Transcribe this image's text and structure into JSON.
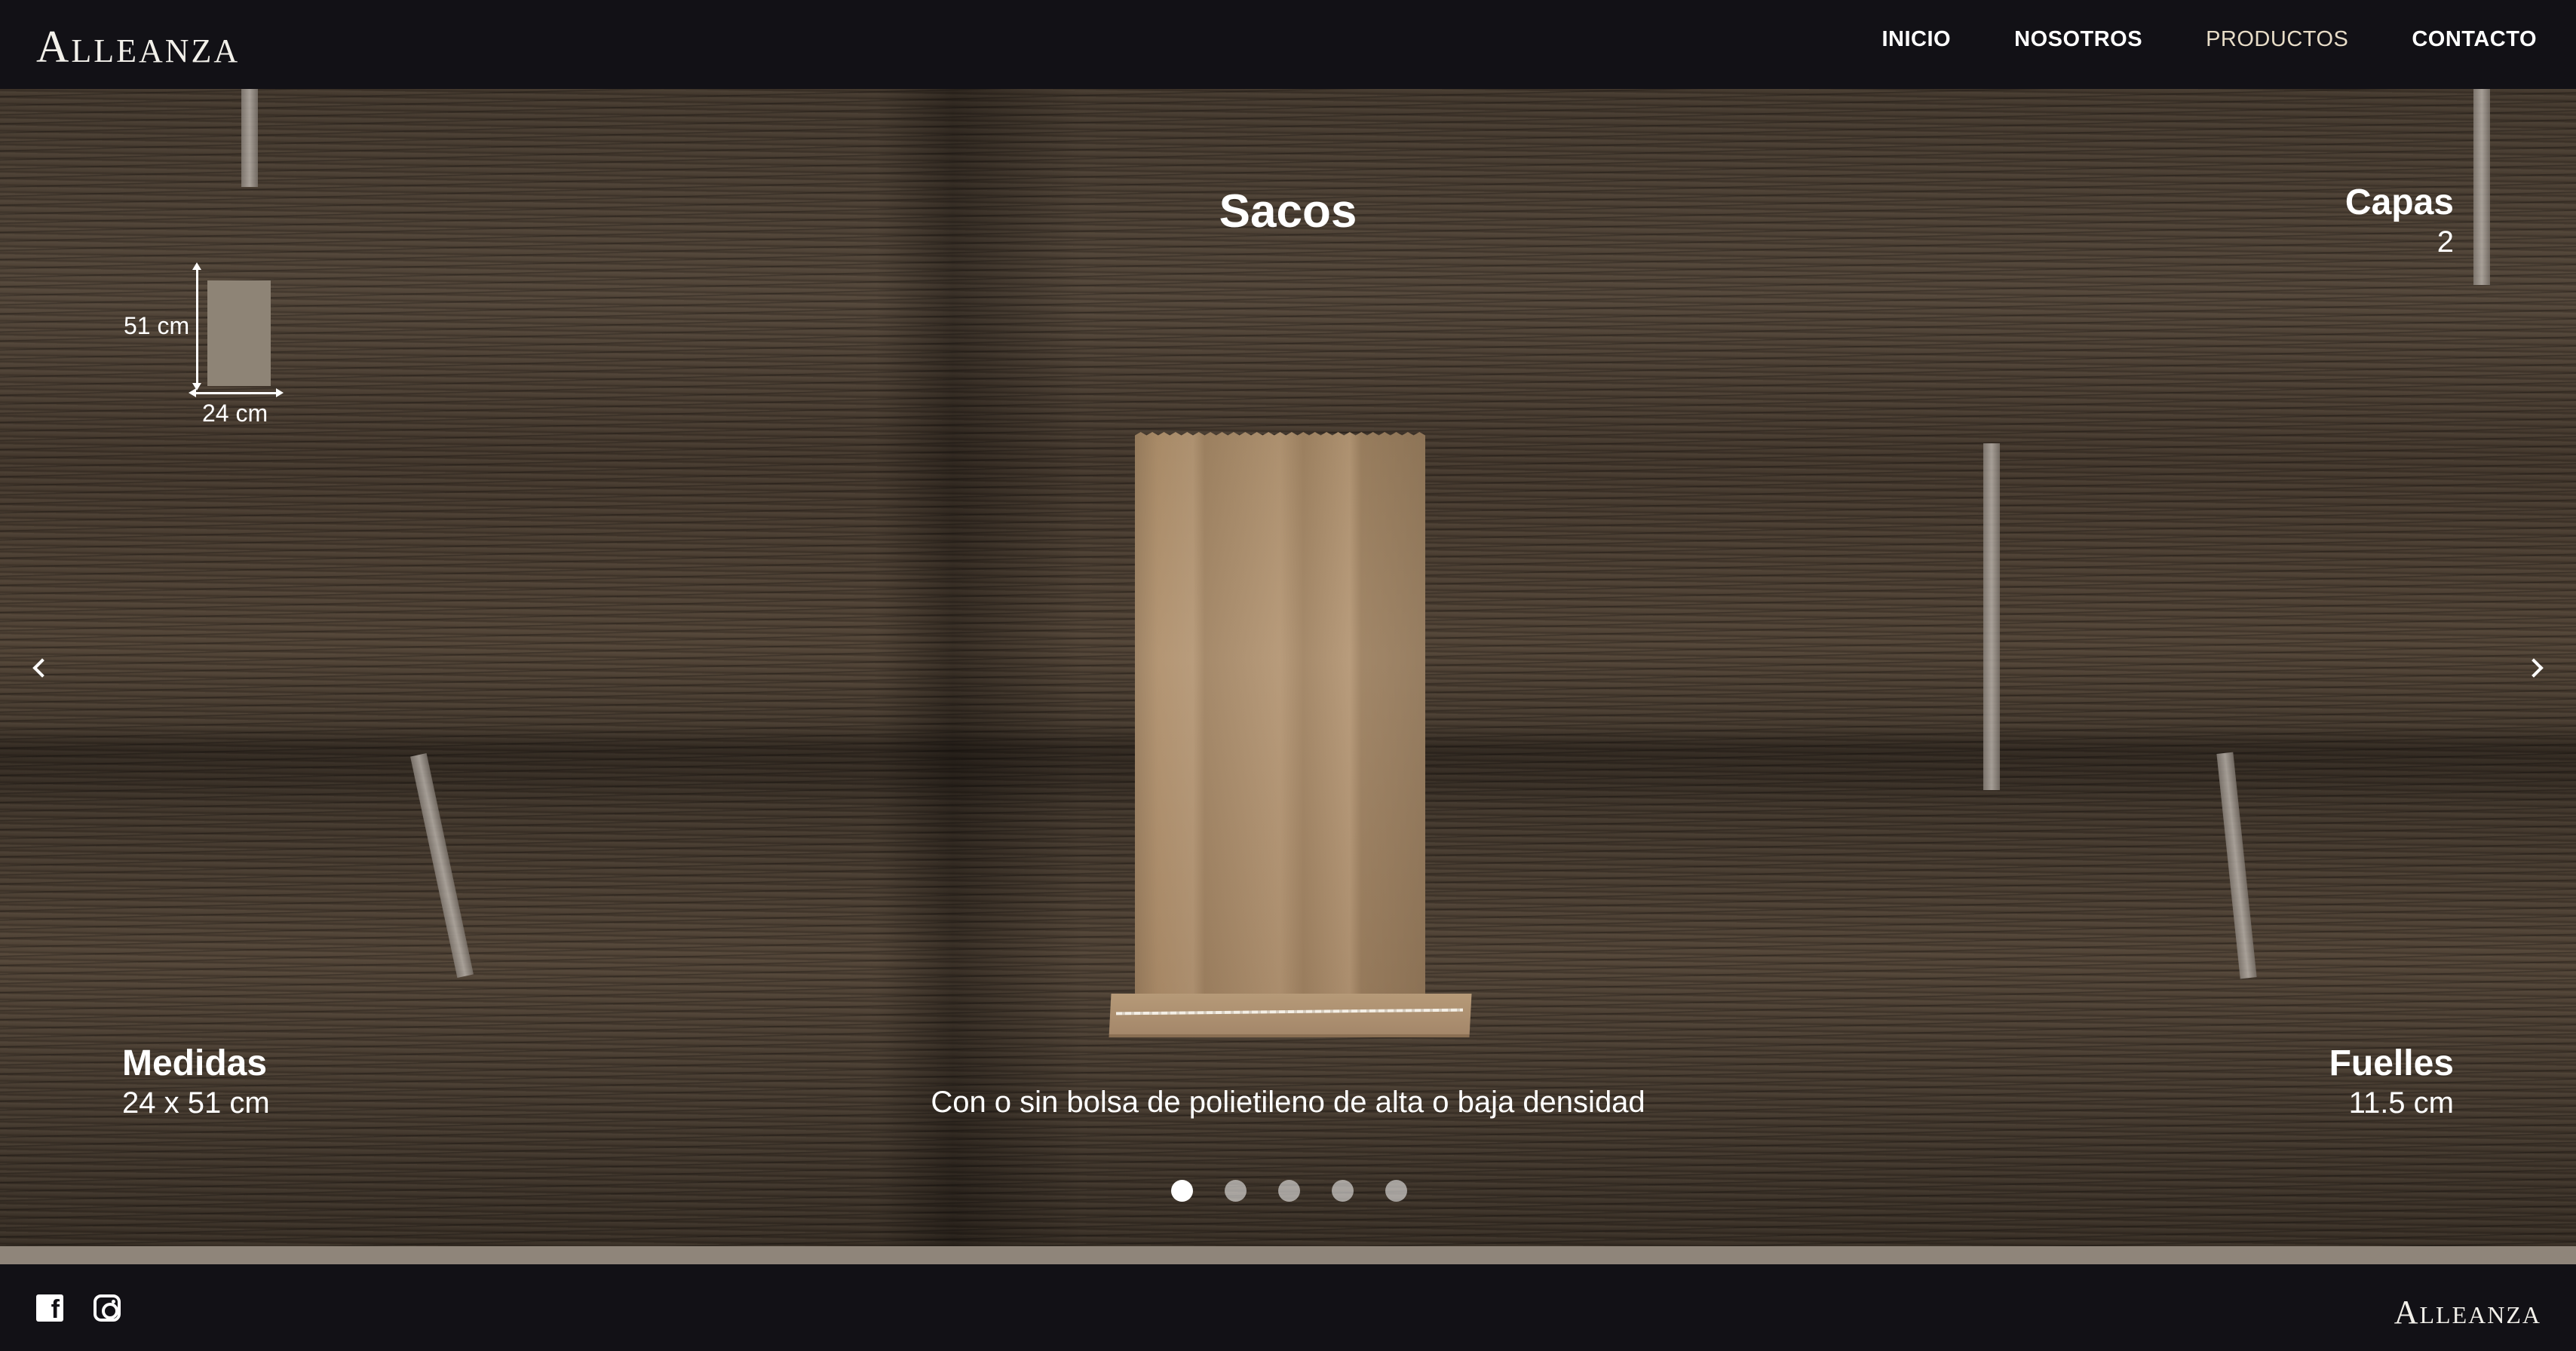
{
  "brand": {
    "logo_first": "A",
    "logo_rest": "LLEANZA"
  },
  "nav": {
    "items": [
      {
        "label": "INICIO",
        "active": false
      },
      {
        "label": "NOSOTROS",
        "active": false
      },
      {
        "label": "PRODUCTOS",
        "active": true
      },
      {
        "label": "CONTACTO",
        "active": false
      }
    ]
  },
  "product": {
    "title": "Sacos",
    "capas": {
      "label": "Capas",
      "value": "2"
    },
    "medidas": {
      "label": "Medidas",
      "value": "24 x 51 cm"
    },
    "fuelles": {
      "label": "Fuelles",
      "value": "11.5 cm"
    },
    "description": "Con o sin bolsa de polietileno de alta o baja densidad",
    "diagram": {
      "height_label": "51 cm",
      "width_label": "24 cm"
    }
  },
  "carousel": {
    "slide_count": 5,
    "active_index": 0
  },
  "footer": {
    "logo_first": "A",
    "logo_rest": "LLEANZA",
    "icons": [
      "facebook-icon",
      "instagram-icon"
    ]
  },
  "colors": {
    "header_bg": "#121116",
    "nav_active": "#e7dcc7",
    "dim_rect": "#8e8476"
  }
}
